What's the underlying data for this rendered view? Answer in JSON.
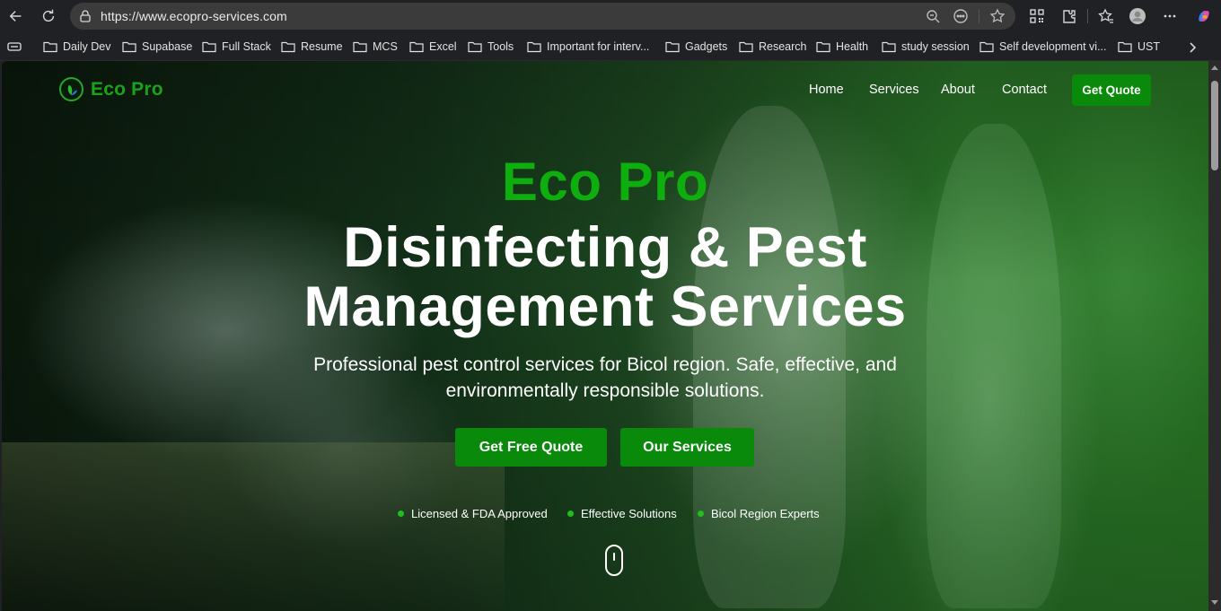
{
  "browser": {
    "url": "https://www.ecopro-services.com",
    "bookmarks": [
      {
        "label": "Daily Dev"
      },
      {
        "label": "Supabase"
      },
      {
        "label": "Full Stack"
      },
      {
        "label": "Resume"
      },
      {
        "label": "MCS"
      },
      {
        "label": "Excel"
      },
      {
        "label": "Tools"
      },
      {
        "label": "Important for interv..."
      },
      {
        "label": "Gadgets"
      },
      {
        "label": "Research"
      },
      {
        "label": "Health"
      },
      {
        "label": "study session"
      },
      {
        "label": "Self development vi..."
      },
      {
        "label": "UST"
      }
    ]
  },
  "site": {
    "logo_text": "Eco Pro",
    "nav": [
      "Home",
      "Services",
      "About",
      "Contact"
    ],
    "cta_top": "Get Quote",
    "brand_color": "#0a8a0a"
  },
  "hero": {
    "brand": "Eco Pro",
    "title_line1": "Disinfecting & Pest",
    "title_line2": "Management Services",
    "subtitle": "Professional pest control services for Bicol region. Safe, effective, and environmentally responsible solutions.",
    "buttons": {
      "quote": "Get Free Quote",
      "services": "Our Services"
    },
    "badges": [
      "Licensed & FDA Approved",
      "Effective Solutions",
      "Bicol Region Experts"
    ]
  }
}
